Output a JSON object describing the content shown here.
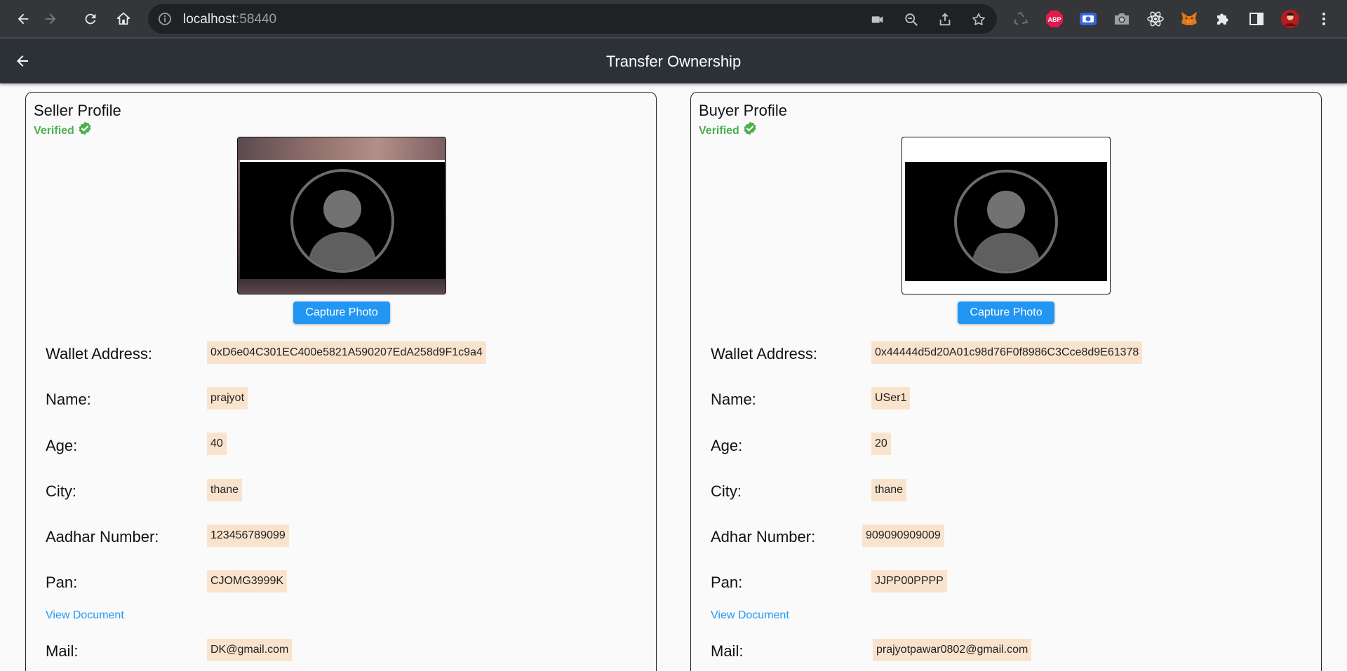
{
  "browser": {
    "url_host": "localhost",
    "url_port": ":58440"
  },
  "app_bar": {
    "title": "Transfer Ownership"
  },
  "seller": {
    "title": "Seller Profile",
    "verified": "Verified",
    "capture_label": "Capture Photo",
    "view_document": "View Document",
    "fields": [
      {
        "label": "Wallet Address:",
        "value": "0xD6e04C301EC400e5821A590207EdA258d9F1c9a4"
      },
      {
        "label": "Name:",
        "value": "prajyot"
      },
      {
        "label": "Age:",
        "value": "40"
      },
      {
        "label": "City:",
        "value": "thane"
      },
      {
        "label": "Aadhar Number:",
        "value": "123456789099"
      },
      {
        "label": "Pan:",
        "value": "CJOMG3999K"
      },
      {
        "label": "Mail:",
        "value": "DK@gmail.com"
      }
    ]
  },
  "buyer": {
    "title": "Buyer Profile",
    "verified": "Verified",
    "capture_label": "Capture Photo",
    "view_document": "View Document",
    "fields": [
      {
        "label": "Wallet Address:",
        "value": "0x44444d5d20A01c98d76F0f8986C3Cce8d9E61378"
      },
      {
        "label": "Name:",
        "value": "USer1"
      },
      {
        "label": "Age:",
        "value": "20"
      },
      {
        "label": "City:",
        "value": "thane"
      },
      {
        "label": "Adhar Number:",
        "value": "909090909009"
      },
      {
        "label": "Pan:",
        "value": "JJPP00PPPP"
      },
      {
        "label": "Mail:",
        "value": "prajyotpawar0802@gmail.com"
      }
    ]
  },
  "colors": {
    "accent": "#2196f3",
    "verified": "#4caf50",
    "value_bg": "#fae3cd",
    "app_bar": "#2b3137"
  },
  "icons": {
    "browser": [
      "back-icon",
      "forward-icon",
      "reload-icon",
      "home-icon",
      "info-icon",
      "camera-icon",
      "zoom-out-icon",
      "share-icon",
      "star-icon"
    ],
    "extensions": [
      "recycle-icon",
      "adblock-icon",
      "screen-record-icon",
      "screenshot-icon",
      "react-icon",
      "metamask-icon",
      "puzzle-icon",
      "side-panel-icon",
      "profile-avatar",
      "menu-icon"
    ],
    "app": [
      "back-arrow-icon",
      "verified-badge-icon",
      "avatar-placeholder-icon"
    ]
  }
}
